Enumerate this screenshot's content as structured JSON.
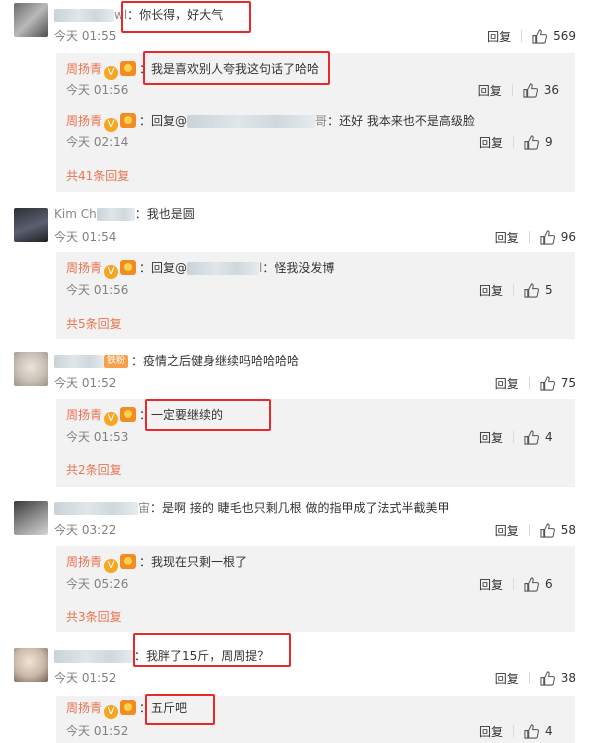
{
  "ui": {
    "reply_label": "回复"
  },
  "highlight_color": "#e8292c",
  "threads": [
    {
      "user_suffix": "wl",
      "text": "你长得，好大气",
      "time": "今天 01:55",
      "likes": "569",
      "replies": [
        {
          "author": "周扬青",
          "reply_to": "",
          "text": "我是喜欢别人夸我这句话了哈哈",
          "time": "今天 01:56",
          "likes": "36"
        },
        {
          "author": "周扬青",
          "reply_to": "回复@",
          "reply_to_suffix": "哥",
          "text": "还好 我本来也不是高级脸",
          "time": "今天 02:14",
          "likes": "9"
        }
      ],
      "more_label": "共41条回复"
    },
    {
      "user_suffix": "Kim Ch",
      "text": "我也是圆",
      "time": "今天 01:54",
      "likes": "96",
      "replies": [
        {
          "author": "周扬青",
          "reply_to": "回复@",
          "reply_to_suffix": "l",
          "text": "怪我没发博",
          "time": "今天 01:56",
          "likes": "5"
        }
      ],
      "more_label": "共5条回复"
    },
    {
      "user_suffix": "",
      "fan_badge": "铁粉",
      "text": "疫情之后健身继续吗哈哈哈哈",
      "time": "今天 01:52",
      "likes": "75",
      "replies": [
        {
          "author": "周扬青",
          "reply_to": "",
          "text": "一定要继续的",
          "time": "今天 01:53",
          "likes": "4"
        }
      ],
      "more_label": "共2条回复"
    },
    {
      "user_suffix": "宙",
      "text": "是啊 接的 睫毛也只剩几根 做的指甲成了法式半截美甲",
      "time": "今天 03:22",
      "likes": "58",
      "replies": [
        {
          "author": "周扬青",
          "reply_to": "",
          "text": "我现在只剩一根了",
          "time": "今天 05:26",
          "likes": "6"
        }
      ],
      "more_label": "共3条回复"
    },
    {
      "user_suffix": "",
      "text": "我胖了15斤，周周提？",
      "time": "今天 01:52",
      "likes": "38",
      "replies": [
        {
          "author": "周扬青",
          "reply_to": "",
          "text": "五斤吧",
          "time": "今天 01:52",
          "likes": "4"
        }
      ],
      "more_label": ""
    }
  ],
  "icons": {
    "thumb": "thumbs-up-icon",
    "verified": "verified-v-icon",
    "medal": "medal-icon"
  }
}
